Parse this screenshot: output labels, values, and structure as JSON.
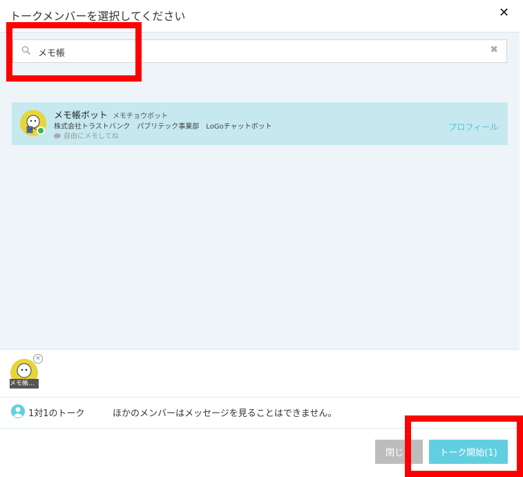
{
  "dialog": {
    "title": "トークメンバーを選択してください",
    "close_glyph": "✕"
  },
  "search": {
    "value": "メモ帳",
    "clear_glyph": "✖"
  },
  "members": [
    {
      "name": "メモ帳ボット",
      "kana": "メモチョウボット",
      "organization": "株式会社トラストバンク　パブリテック事業部　LoGoチャットボット",
      "status_message": "自由にメモしてね",
      "profile_label": "プロフィール",
      "online": true
    }
  ],
  "selected": {
    "chip_label": "メモ帳…",
    "remove_glyph": "✕"
  },
  "talk": {
    "type_label": "1対1のトーク",
    "note": "ほかのメンバーはメッセージを見ることはできません。"
  },
  "buttons": {
    "close_label": "閉じる",
    "start_label": "トーク開始(1)"
  },
  "colors": {
    "accent": "#62cfe0",
    "selected_row": "#c5e9ef",
    "highlight": "#ff0000",
    "online": "#3ab54a"
  }
}
